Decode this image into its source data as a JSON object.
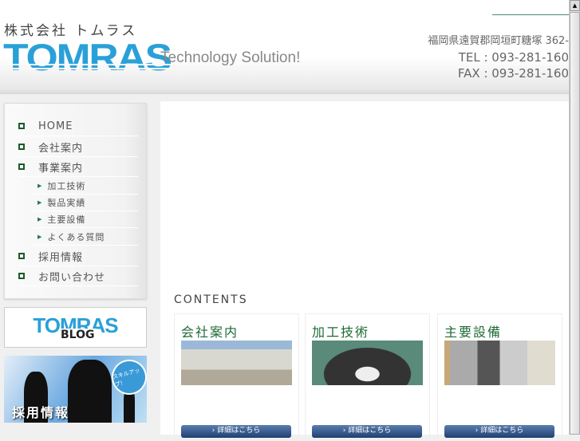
{
  "header": {
    "company_jp": "株式会社 トムラス",
    "logo": "TOMRAS",
    "slogan": "Technology Solution!",
    "address": "福岡県遠賀郡岡垣町糖塚 362-",
    "tel": "TEL : 093-281-160",
    "fax": "FAX : 093-281-160"
  },
  "nav": {
    "items": [
      {
        "label": "HOME"
      },
      {
        "label": "会社案内"
      },
      {
        "label": "事業案内"
      },
      {
        "label": "加工技術"
      },
      {
        "label": "製品実績"
      },
      {
        "label": "主要設備"
      },
      {
        "label": "よくある質問"
      },
      {
        "label": "採用情報"
      },
      {
        "label": "お問い合わせ"
      }
    ]
  },
  "banners": {
    "blog_logo": "TOMRAS",
    "blog_label": "BLOG",
    "recruit_label": "採用情報",
    "recruit_badge": "スキルアップ！"
  },
  "main": {
    "contents_title": "CONTENTS",
    "cards": [
      {
        "title": "会社案内",
        "button": "› 詳細はこちら"
      },
      {
        "title": "加工技術",
        "button": "› 詳細はこちら"
      },
      {
        "title": "主要設備",
        "button": "› 詳細はこちら"
      }
    ]
  }
}
